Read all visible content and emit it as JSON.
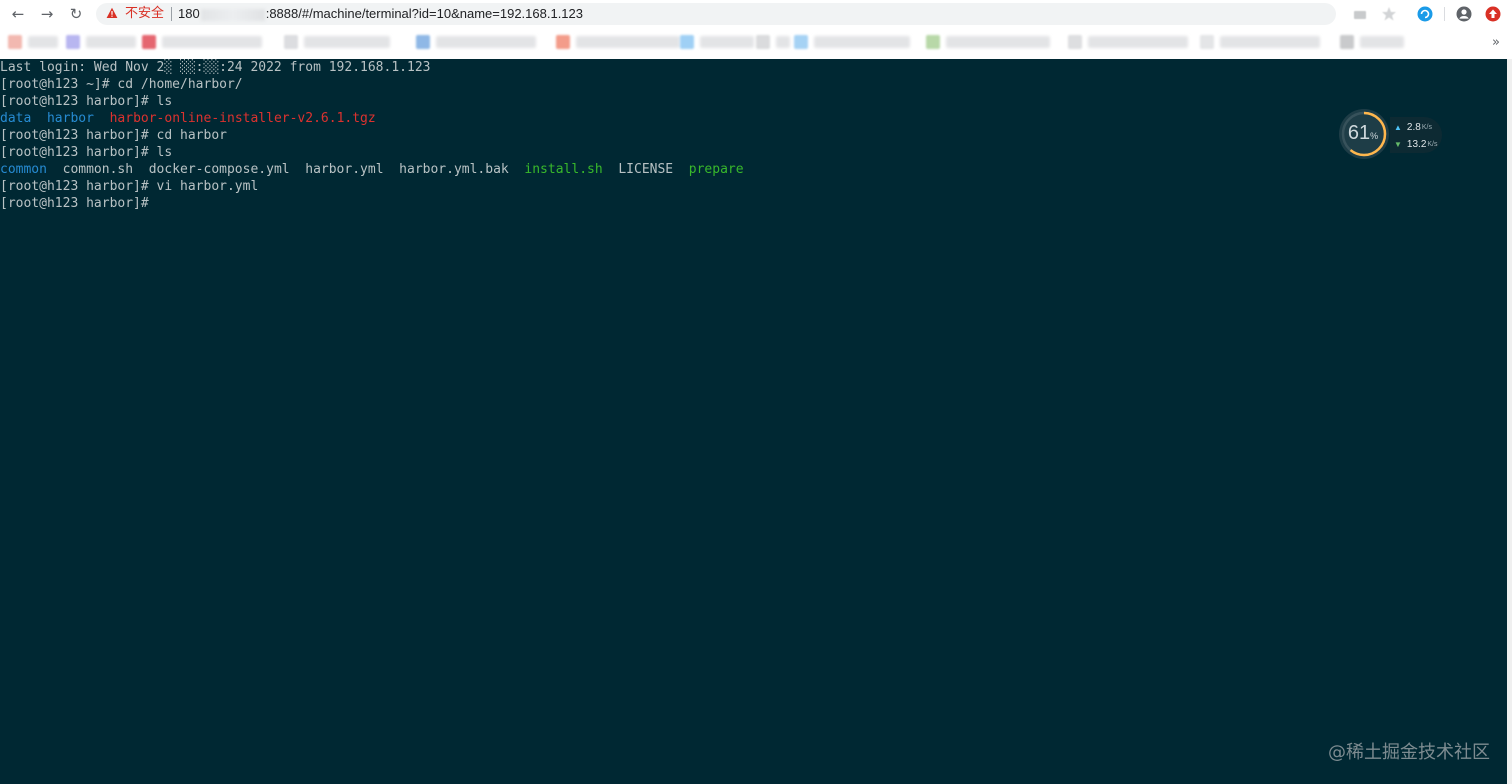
{
  "browser": {
    "back_glyph": "←",
    "forward_glyph": "→",
    "reload_glyph": "↻",
    "insecure_label": "不安全",
    "url_prefix": "180",
    "url_suffix": ":8888/#/machine/terminal?id=10&name=192.168.1.123",
    "more_bookmarks": "»"
  },
  "terminal": {
    "background": "#002833",
    "lines": [
      [
        {
          "t": "Last login: Wed Nov 2░ ░░:░░:24 2022 from 192.168.1.123",
          "c": ""
        }
      ],
      [
        {
          "t": "[root@h123 ~]# cd /home/harbor/",
          "c": ""
        }
      ],
      [
        {
          "t": "[root@h123 harbor]# ls",
          "c": ""
        }
      ],
      [
        {
          "t": "data",
          "c": "c-blue"
        },
        {
          "t": "  ",
          "c": ""
        },
        {
          "t": "harbor",
          "c": "c-blue"
        },
        {
          "t": "  ",
          "c": ""
        },
        {
          "t": "harbor-online-installer-v2.6.1.tgz",
          "c": "c-red"
        }
      ],
      [
        {
          "t": "[root@h123 harbor]# cd harbor",
          "c": ""
        }
      ],
      [
        {
          "t": "[root@h123 harbor]# ls",
          "c": ""
        }
      ],
      [
        {
          "t": "common",
          "c": "c-blue"
        },
        {
          "t": "  common.sh  docker-compose.yml  harbor.yml  harbor.yml.bak  ",
          "c": ""
        },
        {
          "t": "install.sh",
          "c": "c-green"
        },
        {
          "t": "  LICENSE  ",
          "c": ""
        },
        {
          "t": "prepare",
          "c": "c-green"
        }
      ],
      [
        {
          "t": "[root@h123 harbor]# vi harbor.yml",
          "c": ""
        }
      ],
      [
        {
          "t": "[root@h123 harbor]#",
          "c": ""
        }
      ]
    ]
  },
  "net_monitor": {
    "percent": "61",
    "percent_unit": "%",
    "percent_value": 61,
    "upload": "2.8",
    "upload_unit": "K/s",
    "download": "13.2",
    "download_unit": "K/s",
    "upload_color": "#4fc3f7",
    "download_color": "#66bb6a"
  },
  "watermark": "@稀土掘金技术社区"
}
